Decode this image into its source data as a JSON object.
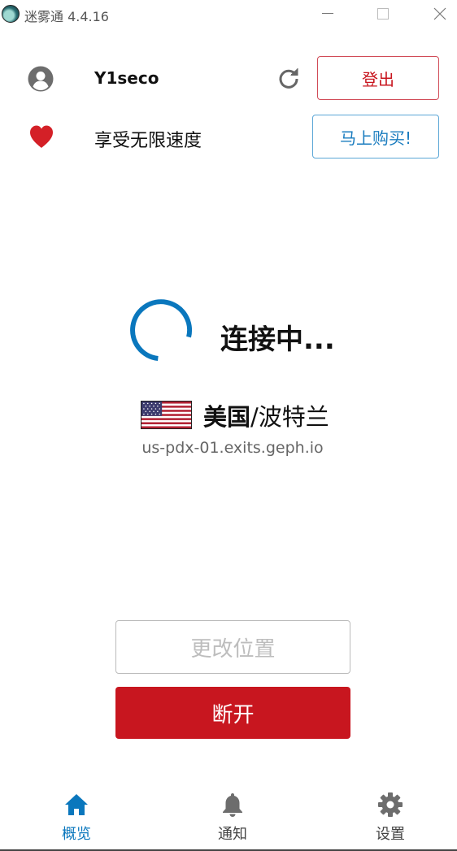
{
  "window": {
    "title": "迷雾通 4.4.16",
    "minimize_glyph": "—",
    "maximize_glyph": "☐",
    "close_glyph": "✕"
  },
  "account": {
    "username": "Y1seco",
    "logout_label": "登出",
    "plus_text": "享受无限速度",
    "buy_label": "马上购买!"
  },
  "status": {
    "text": "连接中...",
    "country": "美国",
    "separator": "/",
    "city": "波特兰",
    "hostname": "us-pdx-01.exits.geph.io"
  },
  "actions": {
    "change_location_label": "更改位置",
    "disconnect_label": "断开"
  },
  "nav": {
    "items": [
      {
        "label": "概览",
        "icon": "home-icon",
        "active": true
      },
      {
        "label": "通知",
        "icon": "bell-icon",
        "active": false
      },
      {
        "label": "设置",
        "icon": "gear-icon",
        "active": false
      }
    ]
  },
  "colors": {
    "accent_blue": "#1a7cbf",
    "danger_red": "#c8161f",
    "heart_red": "#d42027",
    "icon_gray": "#6d6d6d"
  }
}
